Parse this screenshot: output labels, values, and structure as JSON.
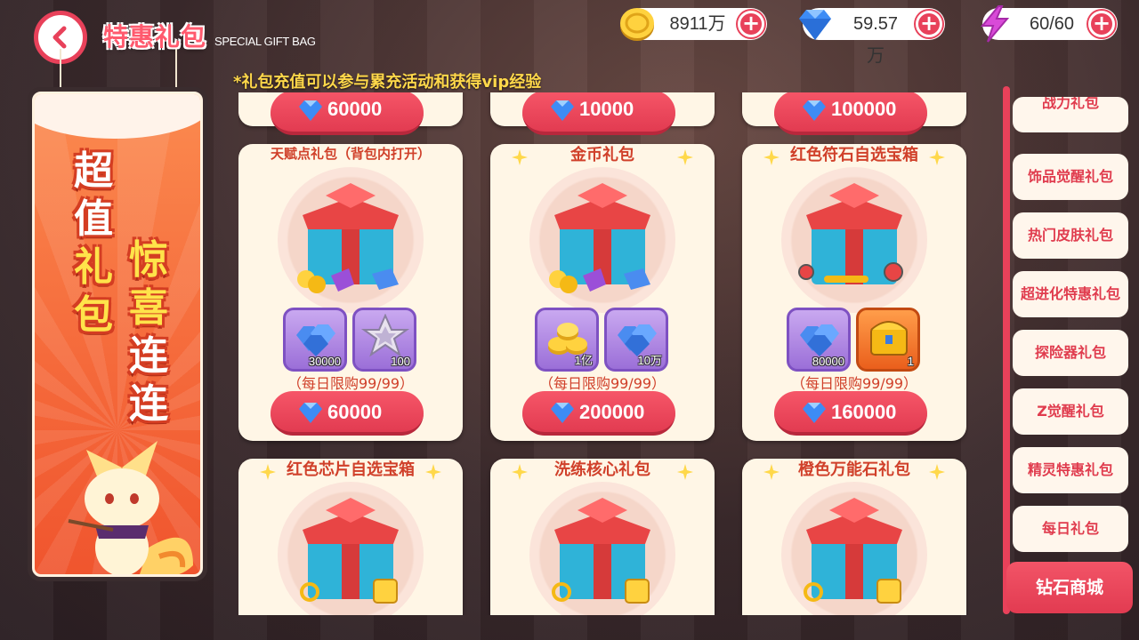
{
  "header": {
    "title": "特惠礼包",
    "subtitle": "SPECIAL GIFT BAG",
    "notice": "*礼包充值可以参与累充活动和获得vip经验"
  },
  "currencies": {
    "gold": {
      "icon": "gold-coin-icon",
      "value": "8911万"
    },
    "diamond": {
      "icon": "diamond-icon",
      "value": "59.57万"
    },
    "energy": {
      "icon": "lightning-icon",
      "value": "60/60"
    }
  },
  "banner": {
    "col1": [
      "超",
      "值",
      "礼",
      "包"
    ],
    "col2": [
      "惊",
      "喜",
      "连",
      "连"
    ]
  },
  "top_row": [
    {
      "price": "60000"
    },
    {
      "price": "10000"
    },
    {
      "price": "100000"
    }
  ],
  "packages": [
    {
      "title": "天赋点礼包（背包内打开）",
      "items": [
        {
          "icon": "diamond-pile-icon",
          "qty": "30000"
        },
        {
          "icon": "star-emblem-icon",
          "qty": "100"
        }
      ],
      "limit": "（每日限购99/99）",
      "price": "60000"
    },
    {
      "title": "金币礼包",
      "items": [
        {
          "icon": "gold-coin-pile-icon",
          "qty": "1亿"
        },
        {
          "icon": "diamond-pile-icon",
          "qty": "10万"
        }
      ],
      "limit": "（每日限购99/99）",
      "price": "200000"
    },
    {
      "title": "红色符石自选宝箱",
      "items": [
        {
          "icon": "diamond-pile-icon",
          "qty": "80000"
        },
        {
          "icon": "treasure-chest-icon",
          "qty": "1"
        }
      ],
      "limit": "（每日限购99/99）",
      "price": "160000"
    }
  ],
  "bottom_row": [
    {
      "title": "红色芯片自选宝箱"
    },
    {
      "title": "洗练核心礼包"
    },
    {
      "title": "橙色万能石礼包"
    }
  ],
  "nav": {
    "items": [
      "战力礼包",
      "饰品觉醒礼包",
      "热门皮肤礼包",
      "超进化特惠礼包",
      "探险器礼包",
      "Z觉醒礼包",
      "精灵特惠礼包",
      "每日礼包"
    ],
    "active": "钻石商城"
  },
  "colors": {
    "accent": "#e8415a",
    "card": "#fff6e6",
    "title": "#d0402a",
    "notice": "#ffd84a"
  }
}
